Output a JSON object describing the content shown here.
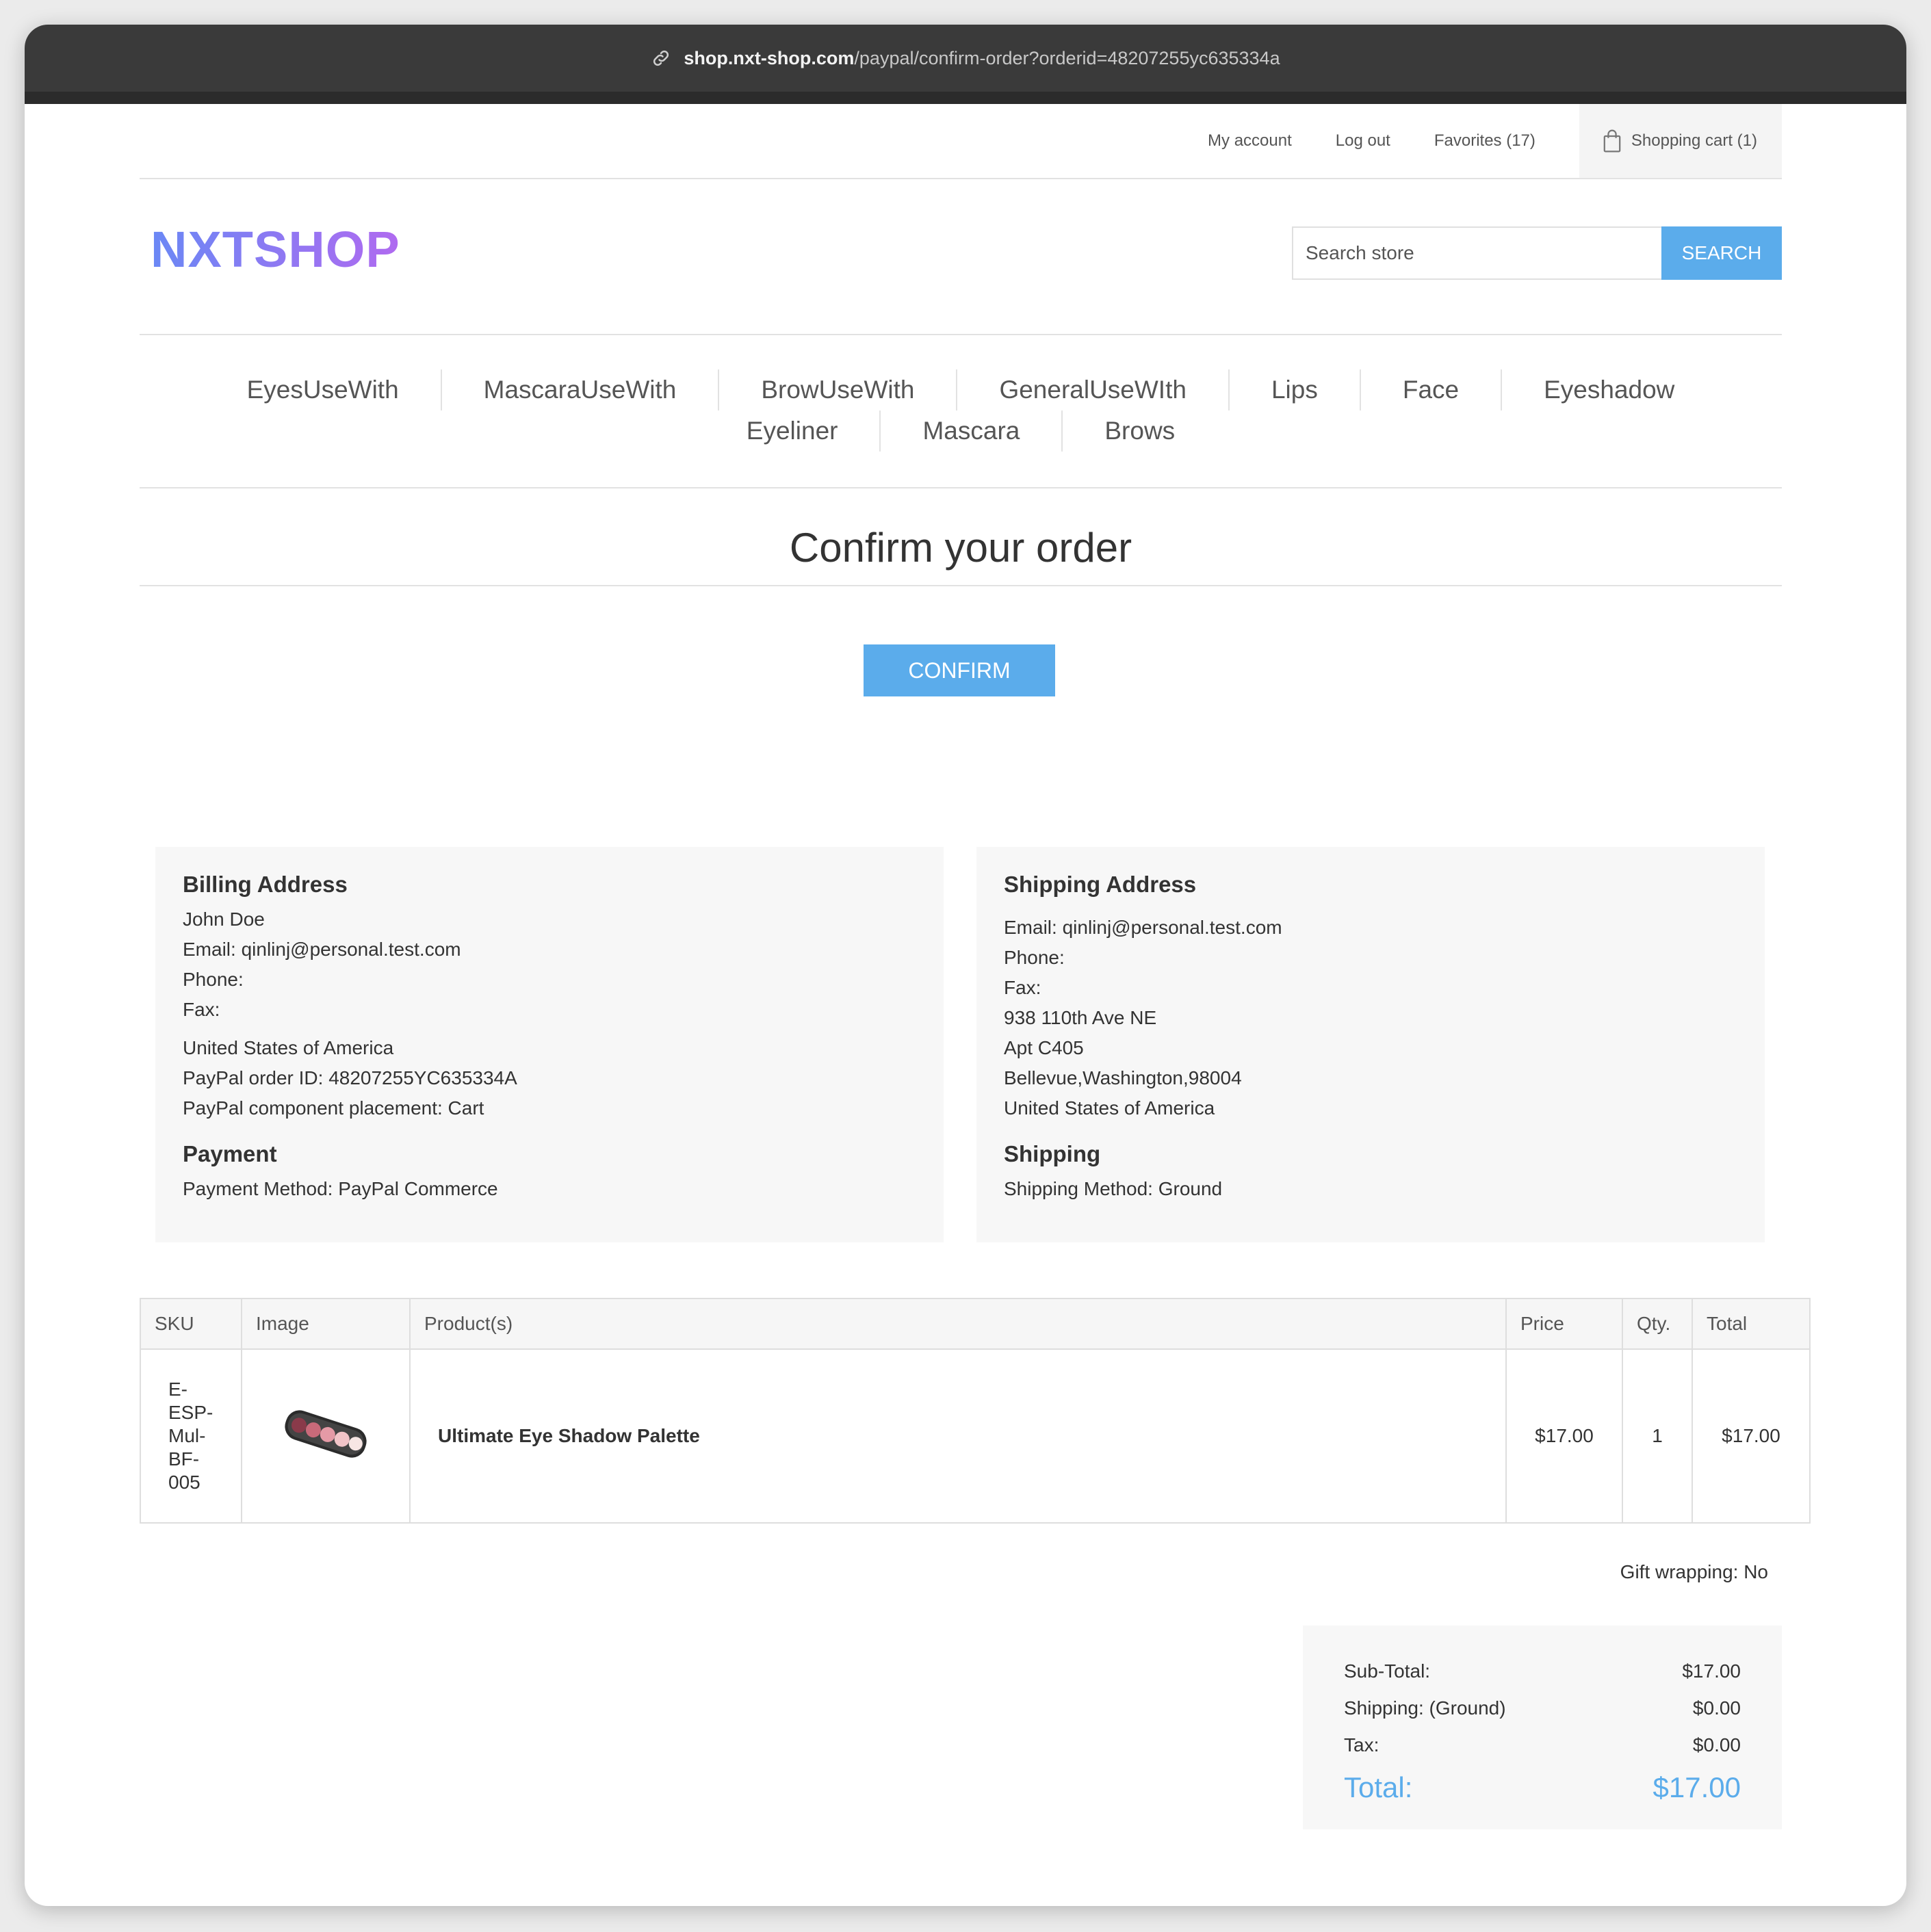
{
  "browser": {
    "url_host": "shop.nxt-shop.com",
    "url_path": "/paypal/confirm-order?orderid=48207255yc635334a"
  },
  "header": {
    "my_account": "My account",
    "log_out": "Log out",
    "favorites": "Favorites (17)",
    "cart": "Shopping cart (1)",
    "logo": "NXTSHOP",
    "search_placeholder": "Search store",
    "search_button": "SEARCH"
  },
  "categories": {
    "row1": [
      "EyesUseWith",
      "MascaraUseWith",
      "BrowUseWith",
      "GeneralUseWIth",
      "Lips",
      "Face",
      "Eyeshadow"
    ],
    "row2": [
      "Eyeliner",
      "Mascara",
      "Brows"
    ]
  },
  "page": {
    "title": "Confirm your order",
    "confirm_button": "CONFIRM"
  },
  "billing": {
    "heading": "Billing Address",
    "name": "John Doe",
    "email": "Email: qinlinj@personal.test.com",
    "phone": "Phone:",
    "fax": "Fax:",
    "country": "United States of America",
    "paypal_order": "PayPal order ID: 48207255YC635334A",
    "paypal_placement": "PayPal component placement: Cart"
  },
  "payment": {
    "heading": "Payment",
    "method": "Payment Method: PayPal Commerce"
  },
  "shipping_address": {
    "heading": "Shipping Address",
    "email": "Email: qinlinj@personal.test.com",
    "phone": "Phone:",
    "fax": "Fax:",
    "street": "938 110th Ave NE",
    "apt": "Apt C405",
    "city": "Bellevue,Washington,98004",
    "country": "United States of America"
  },
  "shipping": {
    "heading": "Shipping",
    "method": "Shipping Method: Ground"
  },
  "table": {
    "headers": [
      "SKU",
      "Image",
      "Product(s)",
      "Price",
      "Qty.",
      "Total"
    ],
    "rows": [
      {
        "sku": "E-ESP-Mul-BF-005",
        "product": "Ultimate Eye Shadow Palette",
        "price": "$17.00",
        "qty": "1",
        "total": "$17.00"
      }
    ]
  },
  "gift_wrapping": "Gift wrapping: No",
  "totals": {
    "subtotal_label": "Sub-Total:",
    "subtotal": "$17.00",
    "shipping_label": "Shipping: (Ground)",
    "shipping": "$0.00",
    "tax_label": "Tax:",
    "tax": "$0.00",
    "total_label": "Total:",
    "total": "$17.00"
  },
  "colors": {
    "accent": "#5baceb",
    "panel": "#f7f7f7",
    "chrome": "#3a3a3a"
  }
}
